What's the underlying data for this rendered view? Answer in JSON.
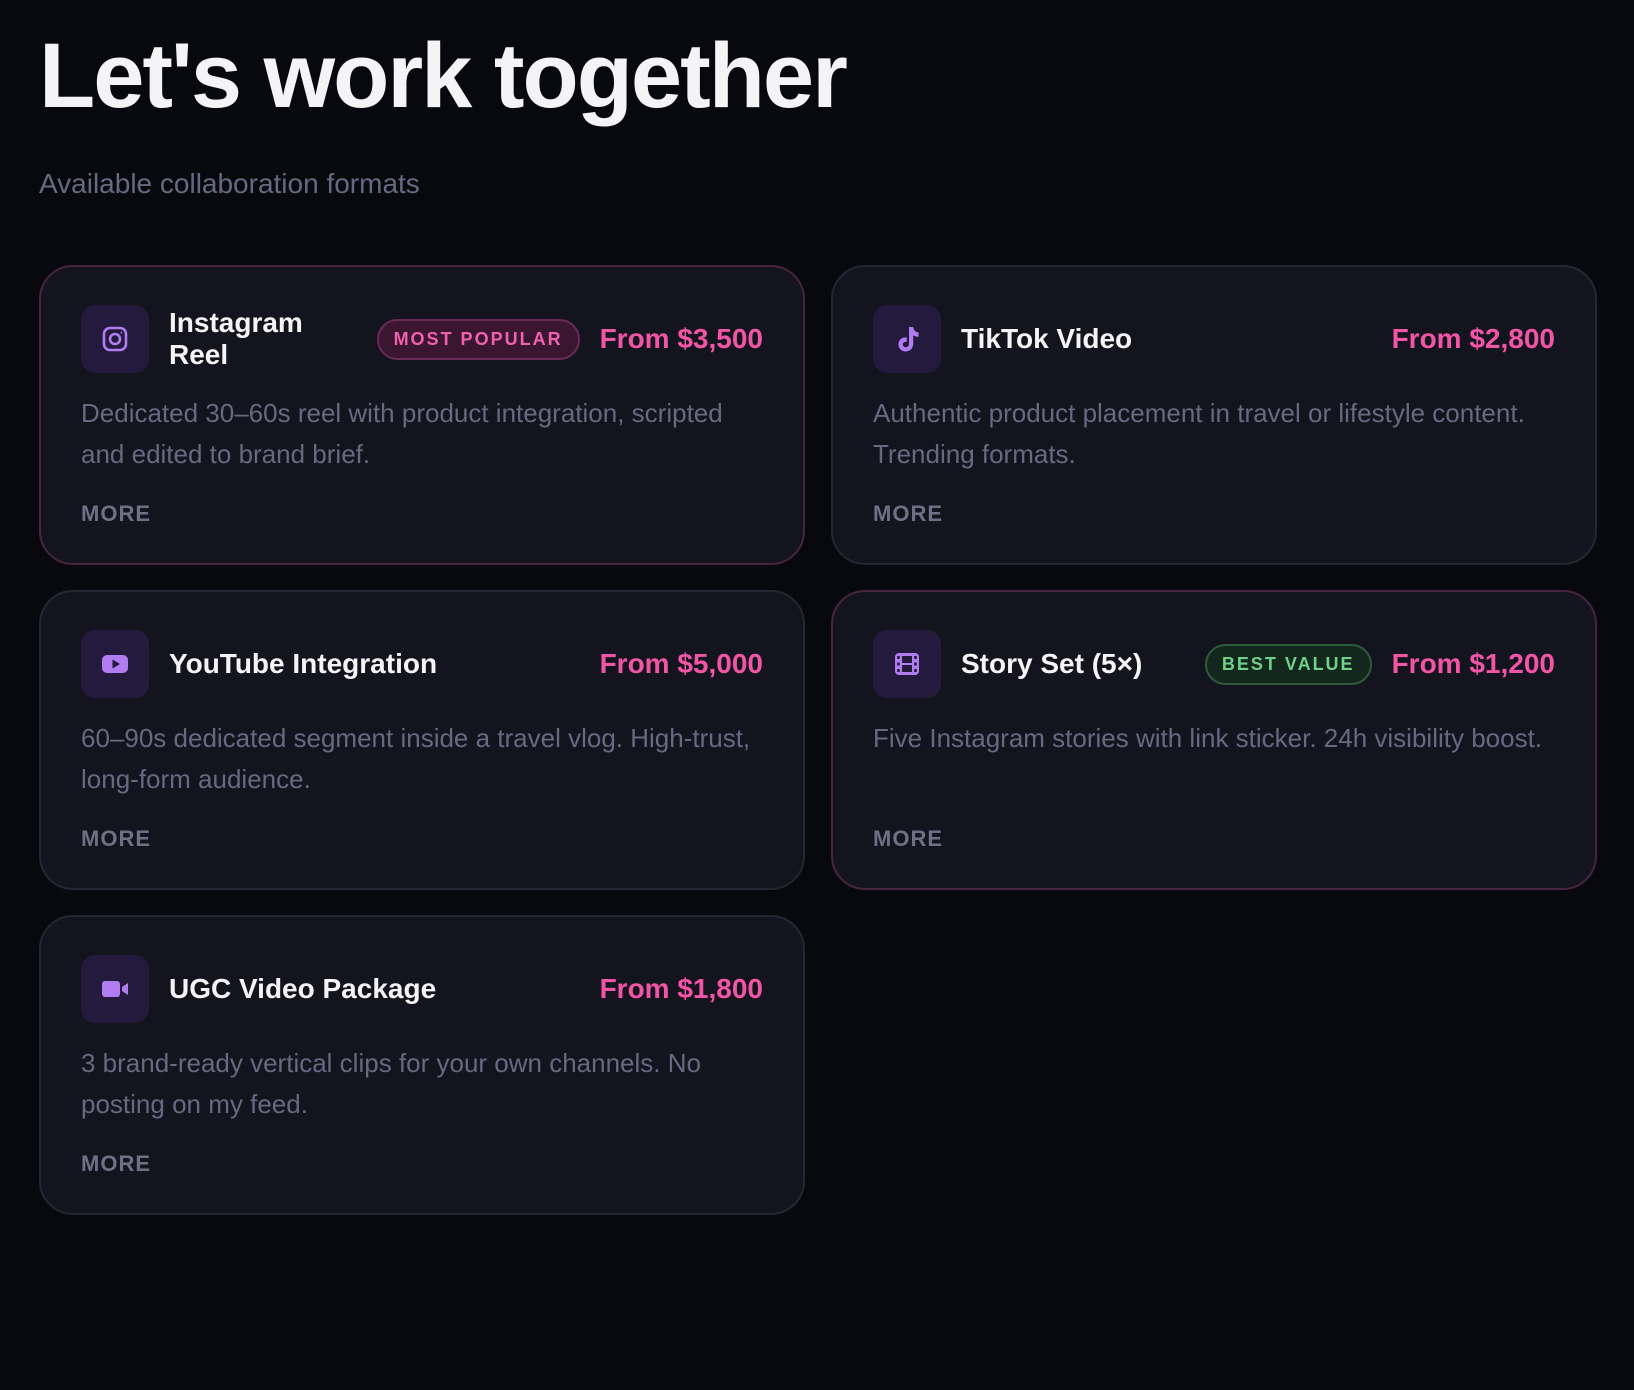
{
  "page": {
    "title": "Let's work together",
    "subtitle": "Available collaboration formats"
  },
  "colors": {
    "background": "#08090e",
    "card": "#14141e",
    "accent_price": "#f255a6",
    "icon": "#b07cf0",
    "badge_popular": "#f060ae",
    "badge_value": "#6fd08a",
    "muted_text": "#6a6880"
  },
  "cards": [
    {
      "name": "Instagram Reel",
      "icon": "instagram-icon",
      "badge": "MOST POPULAR",
      "price": "From $3,500",
      "description": "Dedicated 30–60s reel with product integration, scripted and edited to brand brief.",
      "more_label": "MORE"
    },
    {
      "name": "TikTok Video",
      "icon": "tiktok-icon",
      "price": "From $2,800",
      "description": "Authentic product placement in travel or lifestyle content. Trending formats.",
      "more_label": "MORE"
    },
    {
      "name": "YouTube Integration",
      "icon": "youtube-icon",
      "price": "From $5,000",
      "description": "60–90s dedicated segment inside a travel vlog. High-trust, long-form audience.",
      "more_label": "MORE"
    },
    {
      "name": "Story Set (5×)",
      "icon": "film-icon",
      "badge": "BEST VALUE",
      "price": "From $1,200",
      "description": "Five Instagram stories with link sticker. 24h visibility boost.",
      "more_label": "MORE"
    },
    {
      "name": "UGC Video Package",
      "icon": "video-camera-icon",
      "price": "From $1,800",
      "description": "3 brand-ready vertical clips for your own channels. No posting on my feed.",
      "more_label": "MORE"
    }
  ]
}
